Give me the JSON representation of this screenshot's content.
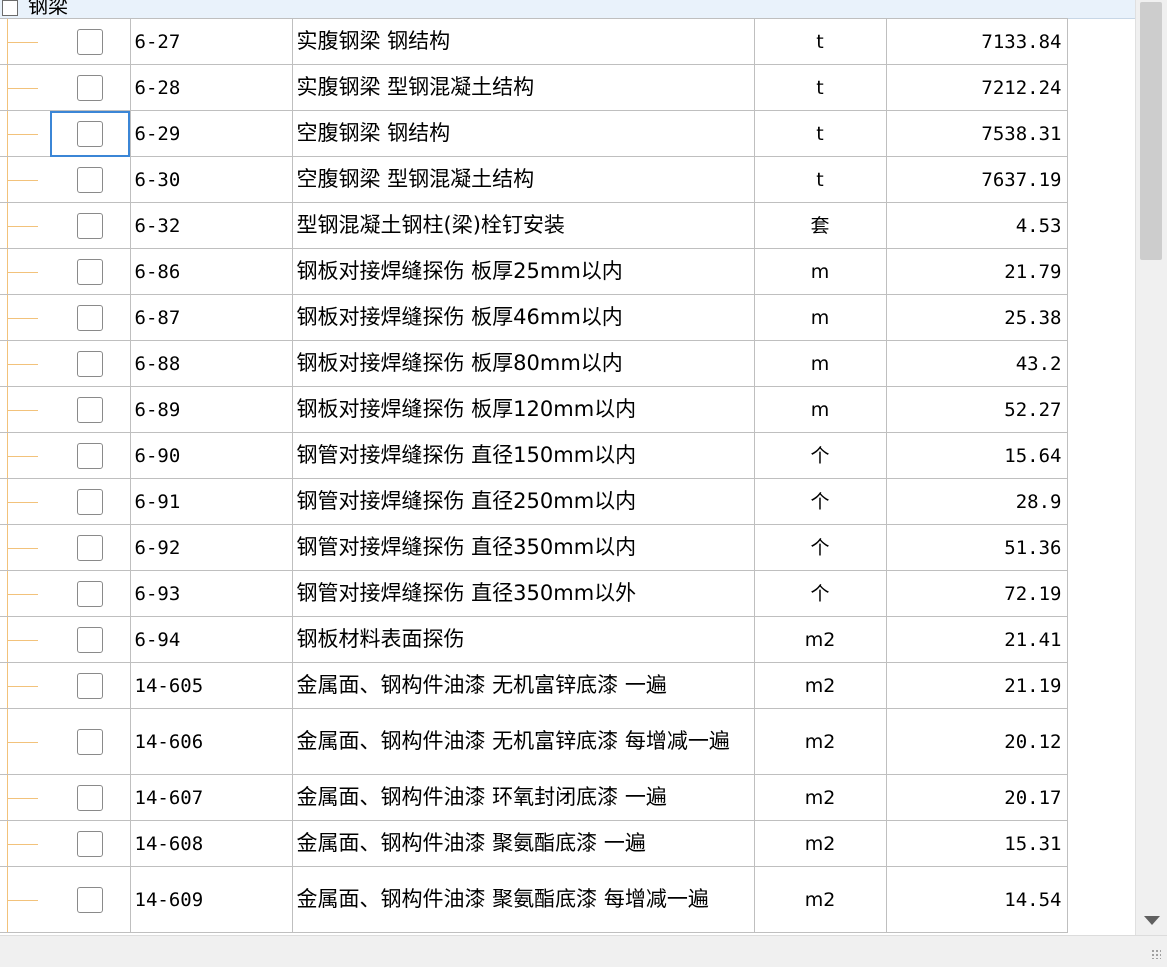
{
  "group": {
    "title": "钢梁"
  },
  "rows": [
    {
      "code": "6-27",
      "name": "实腹钢梁 钢结构",
      "unit": "t",
      "qty": "7133.84"
    },
    {
      "code": "6-28",
      "name": "实腹钢梁 型钢混凝土结构",
      "unit": "t",
      "qty": "7212.24"
    },
    {
      "code": "6-29",
      "name": "空腹钢梁 钢结构",
      "unit": "t",
      "qty": "7538.31"
    },
    {
      "code": "6-30",
      "name": "空腹钢梁 型钢混凝土结构",
      "unit": "t",
      "qty": "7637.19"
    },
    {
      "code": "6-32",
      "name": "型钢混凝土钢柱(梁)栓钉安装",
      "unit": "套",
      "qty": "4.53"
    },
    {
      "code": "6-86",
      "name": "钢板对接焊缝探伤 板厚25mm以内",
      "unit": "m",
      "qty": "21.79"
    },
    {
      "code": "6-87",
      "name": "钢板对接焊缝探伤 板厚46mm以内",
      "unit": "m",
      "qty": "25.38"
    },
    {
      "code": "6-88",
      "name": "钢板对接焊缝探伤 板厚80mm以内",
      "unit": "m",
      "qty": "43.2"
    },
    {
      "code": "6-89",
      "name": "钢板对接焊缝探伤 板厚120mm以内",
      "unit": "m",
      "qty": "52.27"
    },
    {
      "code": "6-90",
      "name": "钢管对接焊缝探伤 直径150mm以内",
      "unit": "个",
      "qty": "15.64"
    },
    {
      "code": "6-91",
      "name": "钢管对接焊缝探伤 直径250mm以内",
      "unit": "个",
      "qty": "28.9"
    },
    {
      "code": "6-92",
      "name": "钢管对接焊缝探伤 直径350mm以内",
      "unit": "个",
      "qty": "51.36"
    },
    {
      "code": "6-93",
      "name": "钢管对接焊缝探伤 直径350mm以外",
      "unit": "个",
      "qty": "72.19"
    },
    {
      "code": "6-94",
      "name": "钢板材料表面探伤",
      "unit": "m2",
      "qty": "21.41"
    },
    {
      "code": "14-605",
      "name": "金属面、钢构件油漆 无机富锌底漆 一遍",
      "unit": "m2",
      "qty": "21.19"
    },
    {
      "code": "14-606",
      "name": "金属面、钢构件油漆 无机富锌底漆 每增减一遍",
      "unit": "m2",
      "qty": "20.12"
    },
    {
      "code": "14-607",
      "name": "金属面、钢构件油漆 环氧封闭底漆 一遍",
      "unit": "m2",
      "qty": "20.17"
    },
    {
      "code": "14-608",
      "name": "金属面、钢构件油漆 聚氨酯底漆 一遍",
      "unit": "m2",
      "qty": "15.31"
    },
    {
      "code": "14-609",
      "name": "金属面、钢构件油漆 聚氨酯底漆 每增减一遍",
      "unit": "m2",
      "qty": "14.54"
    }
  ],
  "colors": {
    "tree_line": "#f2c27b",
    "focus": "#3b86d6",
    "grid": "#bfbfbf",
    "header_bg": "#e9f2fb"
  }
}
